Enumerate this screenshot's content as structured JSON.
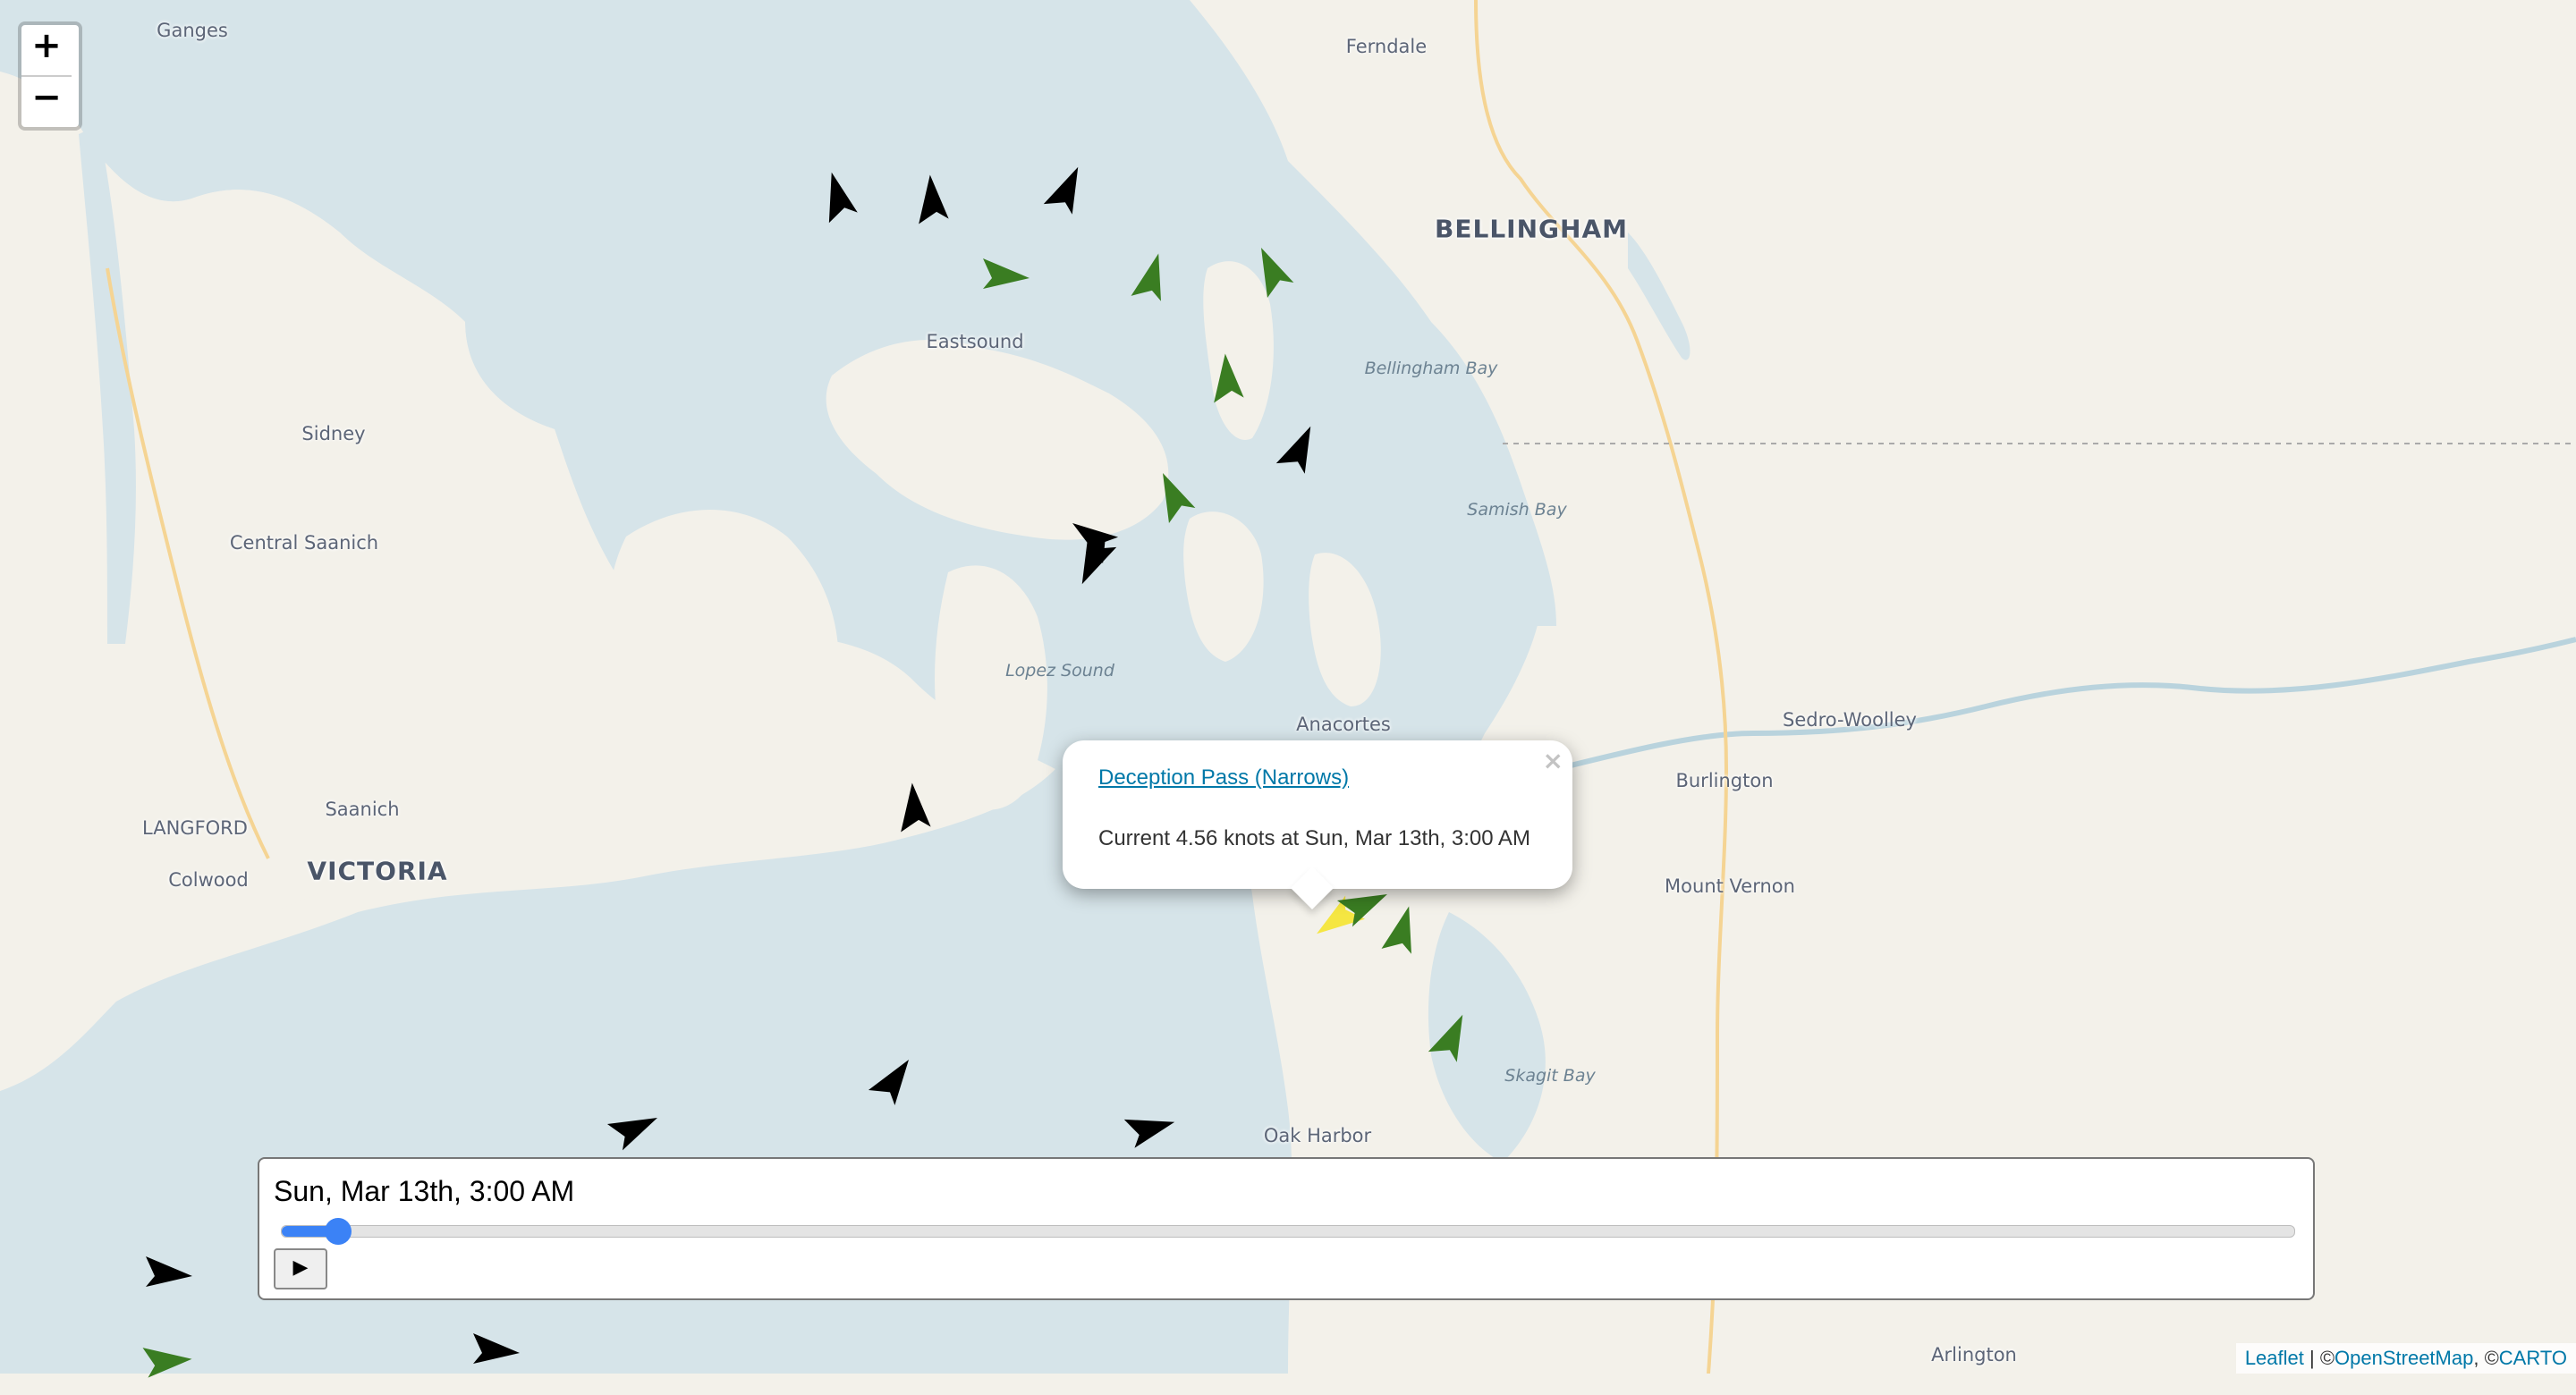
{
  "map": {
    "colors": {
      "water": "#d6e4e9",
      "land": "#f3f1ea",
      "current_flood": "#3a7d22",
      "current_ebb": "#000000",
      "selected": "#f5e642"
    },
    "places": [
      {
        "id": "ganges",
        "label": "Ganges",
        "kind": "small"
      },
      {
        "id": "ferndale",
        "label": "Ferndale",
        "kind": "small"
      },
      {
        "id": "bellingham",
        "label": "BELLINGHAM",
        "kind": "city"
      },
      {
        "id": "eastsound",
        "label": "Eastsound",
        "kind": "small"
      },
      {
        "id": "bellingham-bay",
        "label": "Bellingham Bay",
        "kind": "water"
      },
      {
        "id": "sidney",
        "label": "Sidney",
        "kind": "small"
      },
      {
        "id": "samish-bay",
        "label": "Samish Bay",
        "kind": "water"
      },
      {
        "id": "central-saanich",
        "label": "Central Saanich",
        "kind": "small"
      },
      {
        "id": "lopez-sound",
        "label": "Lopez Sound",
        "kind": "water"
      },
      {
        "id": "anacortes",
        "label": "Anacortes",
        "kind": "small"
      },
      {
        "id": "sedro-woolley",
        "label": "Sedro-Woolley",
        "kind": "small"
      },
      {
        "id": "burlington",
        "label": "Burlington",
        "kind": "small"
      },
      {
        "id": "saanich",
        "label": "Saanich",
        "kind": "small"
      },
      {
        "id": "langford",
        "label": "LANGFORD",
        "kind": "small"
      },
      {
        "id": "victoria",
        "label": "VICTORIA",
        "kind": "city"
      },
      {
        "id": "colwood",
        "label": "Colwood",
        "kind": "small"
      },
      {
        "id": "mount-vernon",
        "label": "Mount Vernon",
        "kind": "small"
      },
      {
        "id": "skagit-bay",
        "label": "Skagit Bay",
        "kind": "water"
      },
      {
        "id": "oak-harbor",
        "label": "Oak Harbor",
        "kind": "small"
      },
      {
        "id": "arlington",
        "label": "Arlington",
        "kind": "small"
      }
    ]
  },
  "zoom": {
    "in_label": "+",
    "out_label": "−"
  },
  "popup": {
    "station": "Deception Pass (Narrows)",
    "text": "Current 4.56 knots at Sun, Mar 13th, 3:00 AM",
    "close_label": "×"
  },
  "timeline": {
    "title": "Sun, Mar 13th, 3:00 AM",
    "position_fraction": 0.028,
    "play_label": "▶"
  },
  "attribution": {
    "leaflet": "Leaflet",
    "sep": " | ©",
    "osm": "OpenStreetMap",
    "sep2": ", ©",
    "carto": "CARTO"
  }
}
